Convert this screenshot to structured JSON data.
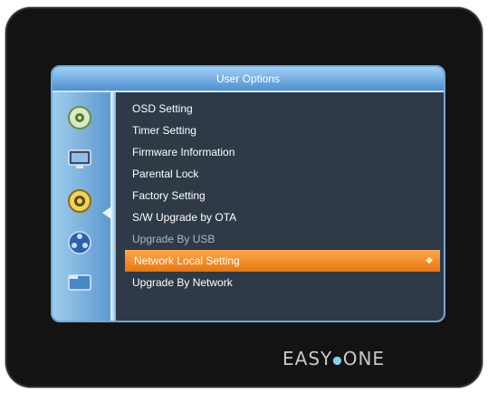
{
  "window": {
    "title": "User Options"
  },
  "sidebar": {
    "icons": [
      "satellite-dish-icon",
      "tv-monitor-icon",
      "settings-gear-icon",
      "film-reel-icon",
      "folder-icon"
    ]
  },
  "menu": {
    "items": [
      {
        "label": "OSD Setting",
        "state": "normal"
      },
      {
        "label": "Timer Setting",
        "state": "normal"
      },
      {
        "label": "Firmware Information",
        "state": "normal"
      },
      {
        "label": "Parental Lock",
        "state": "normal"
      },
      {
        "label": "Factory Setting",
        "state": "normal"
      },
      {
        "label": "S/W Upgrade by OTA",
        "state": "normal"
      },
      {
        "label": "Upgrade By USB",
        "state": "disabled"
      },
      {
        "label": "Network Local Setting",
        "state": "selected"
      },
      {
        "label": "Upgrade By Network",
        "state": "normal"
      }
    ]
  },
  "brand": {
    "left": "EASY",
    "right": "ONE"
  },
  "colors": {
    "selected_bg": "#f0891e",
    "title_bar": "#6aa8de",
    "screen_bg": "#2f3a47"
  }
}
